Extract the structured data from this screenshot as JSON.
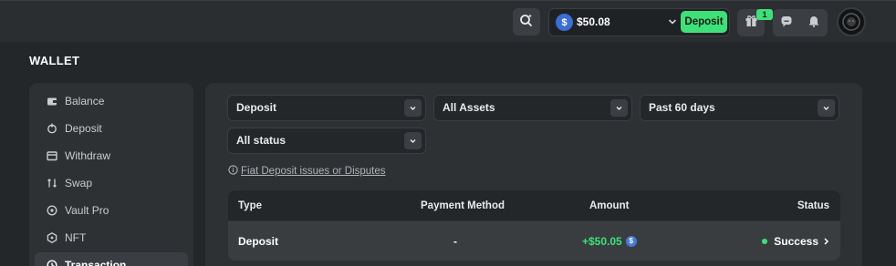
{
  "header": {
    "balance": "$50.08",
    "balance_currency_icon": "usdc-coin-icon",
    "deposit_label": "Deposit",
    "gift_badge_count": "1",
    "accent_color": "#3ee07a"
  },
  "page_title": "WALLET",
  "sidebar": {
    "items": [
      {
        "label": "Balance",
        "icon": "wallet-icon"
      },
      {
        "label": "Deposit",
        "icon": "deposit-icon"
      },
      {
        "label": "Withdraw",
        "icon": "withdraw-icon"
      },
      {
        "label": "Swap",
        "icon": "swap-icon"
      },
      {
        "label": "Vault Pro",
        "icon": "vault-icon"
      },
      {
        "label": "NFT",
        "icon": "nft-icon"
      },
      {
        "label": "Transaction",
        "icon": "transaction-icon"
      }
    ]
  },
  "filters": {
    "type": "Deposit",
    "assets": "All Assets",
    "period": "Past 60 days",
    "status": "All status"
  },
  "fiat_link": "Fiat Deposit issues or Disputes",
  "table": {
    "columns": [
      "Type",
      "Payment Method",
      "Amount",
      "Status"
    ],
    "rows": [
      {
        "type": "Deposit",
        "method": "-",
        "amount": "+$50.05",
        "status": "Success"
      }
    ]
  }
}
